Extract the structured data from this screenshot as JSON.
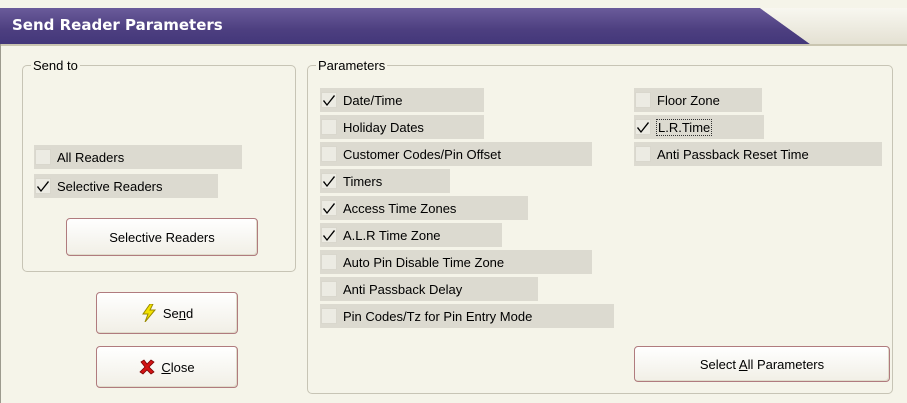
{
  "window": {
    "title": "Send Reader Parameters"
  },
  "send_to": {
    "legend": "Send to",
    "options": [
      {
        "label": "All Readers",
        "checked": false
      },
      {
        "label": "Selective Readers",
        "checked": true
      }
    ],
    "selective_button": "Selective Readers"
  },
  "parameters": {
    "legend": "Parameters",
    "left_column": [
      {
        "label": "Date/Time",
        "checked": true
      },
      {
        "label": "Holiday Dates",
        "checked": false
      },
      {
        "label": "Customer Codes/Pin Offset",
        "checked": false
      },
      {
        "label": "Timers",
        "checked": true
      },
      {
        "label": "Access Time Zones",
        "checked": true
      },
      {
        "label": "A.L.R Time Zone",
        "checked": true
      },
      {
        "label": "Auto Pin Disable Time Zone",
        "checked": false
      },
      {
        "label": "Anti Passback Delay",
        "checked": false
      },
      {
        "label": "Pin Codes/Tz for Pin Entry Mode",
        "checked": false
      }
    ],
    "right_column": [
      {
        "label": "Floor Zone",
        "checked": false
      },
      {
        "label": "L.R.Time",
        "checked": true
      },
      {
        "label": "Anti Passback Reset Time",
        "checked": false
      }
    ],
    "select_all_button": {
      "before": "Select ",
      "accel": "A",
      "after": "ll Parameters"
    }
  },
  "buttons": {
    "send": {
      "before": "Se",
      "accel": "n",
      "after": "d"
    },
    "close": {
      "before": "",
      "accel": "C",
      "after": "lose"
    }
  },
  "icons": {
    "send": "lightning-icon",
    "close": "red-x-icon"
  }
}
